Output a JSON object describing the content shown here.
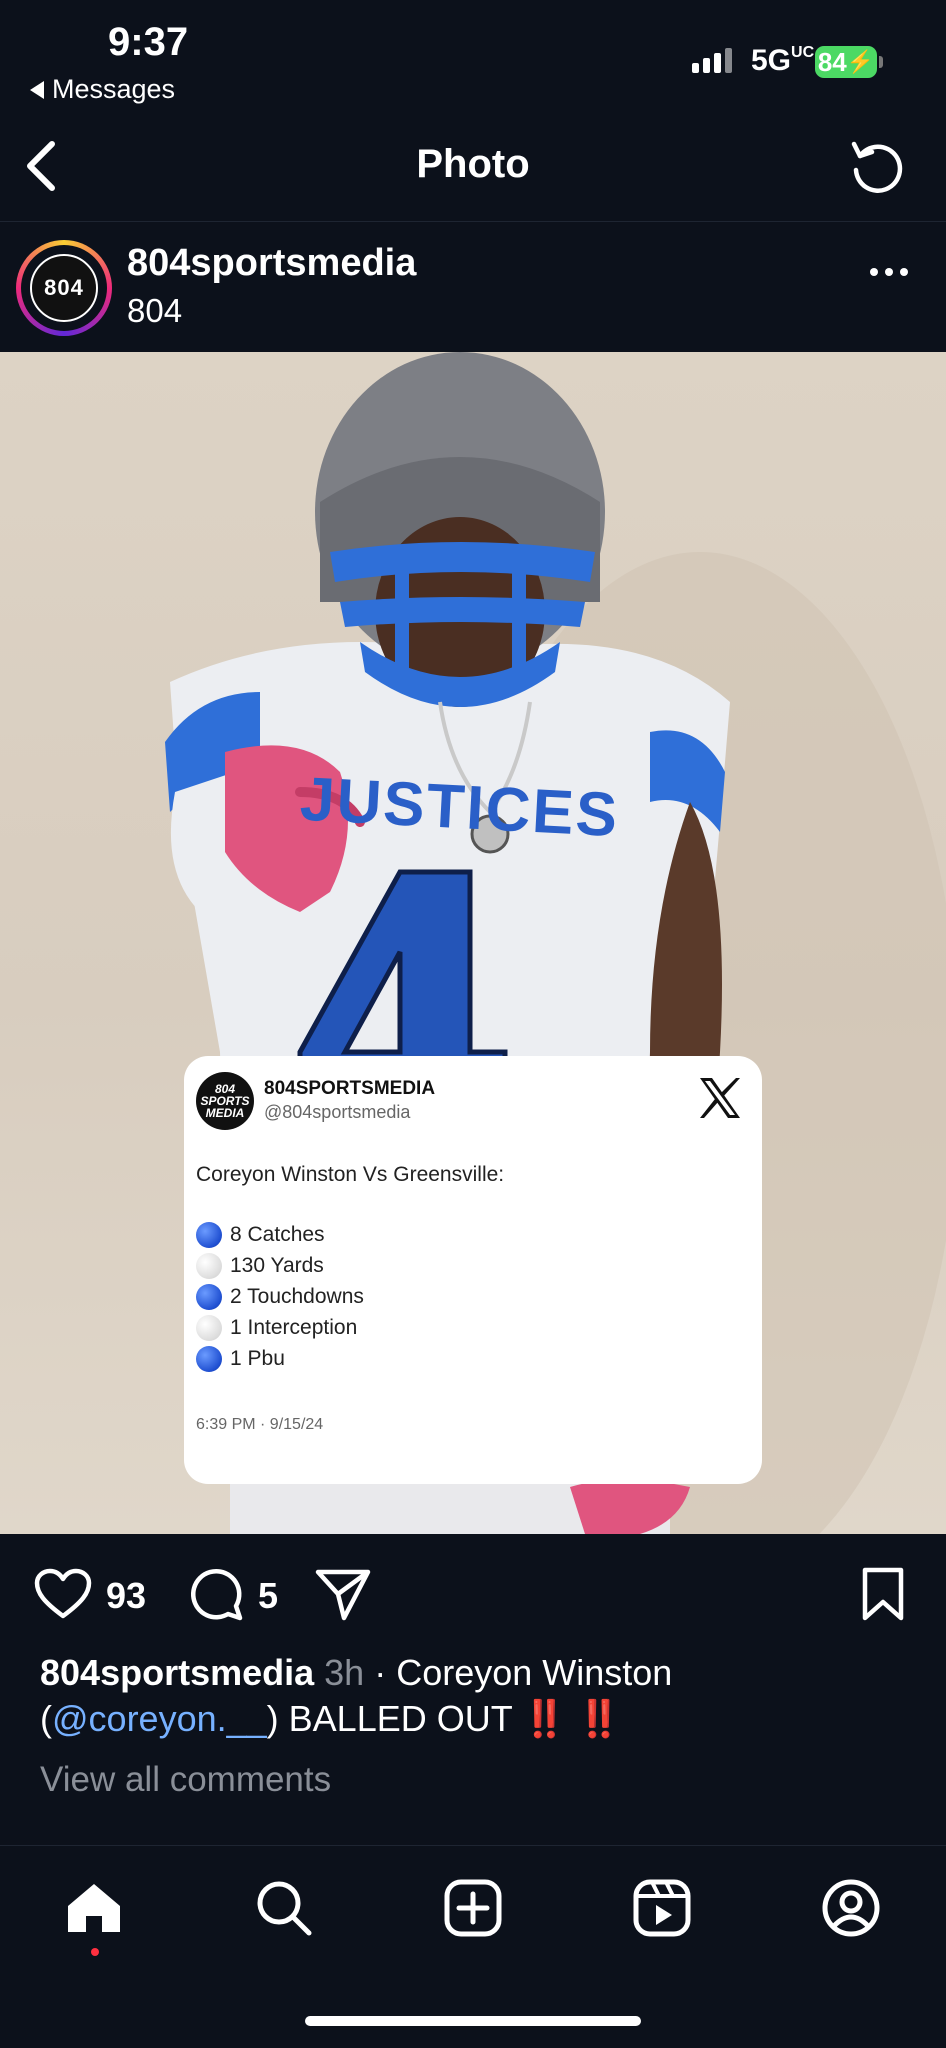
{
  "status_bar": {
    "time": "9:37",
    "back_app": "Messages",
    "network": "5G",
    "network_suffix": "UC",
    "battery": "84"
  },
  "nav": {
    "title": "Photo"
  },
  "post": {
    "username": "804sportsmedia",
    "subtitle": "804",
    "avatar_text": "804",
    "likes": "93",
    "comments": "5",
    "caption": {
      "username": "804sportsmedia",
      "time": "3h",
      "text_before": " · Coreyon Winston (",
      "mention": "@coreyon.__",
      "text_after": ") BALLED OUT ",
      "emoji": "‼️ ‼️"
    },
    "view_comments": "View all comments"
  },
  "photo": {
    "jersey_text": "JUSTICES",
    "jersey_number": "4"
  },
  "tweet_card": {
    "logo_text": "804 SPORTS MEDIA",
    "name": "804SPORTSMEDIA",
    "handle": "@804sportsmedia",
    "headline": "Coreyon Winston Vs Greensville:",
    "stats": [
      {
        "label": "8 Catches",
        "color": "blue"
      },
      {
        "label": "130 Yards",
        "color": "white"
      },
      {
        "label": "2 Touchdowns",
        "color": "blue"
      },
      {
        "label": "1 Interception",
        "color": "white"
      },
      {
        "label": "1 Pbu",
        "color": "blue"
      }
    ],
    "timestamp": "6:39 PM · 9/15/24"
  },
  "colors": {
    "background": "#0c111b",
    "mention": "#77b1ff",
    "notification_dot": "#ff3040"
  }
}
